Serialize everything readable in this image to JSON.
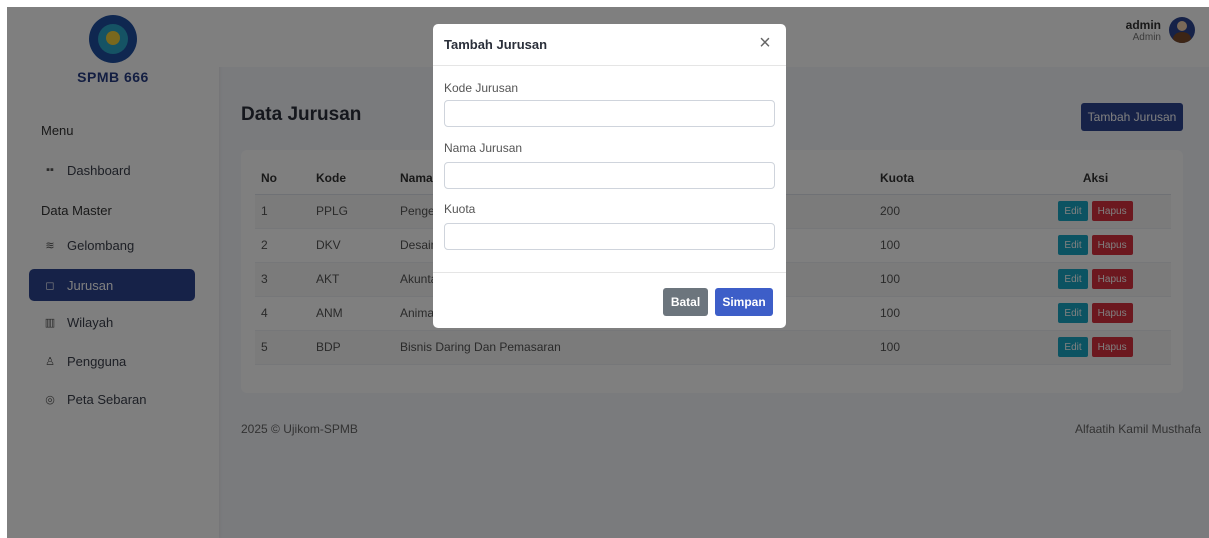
{
  "sidebar": {
    "brand": "SPMB 666",
    "menu_label": "Menu",
    "data_master_label": "Data Master",
    "items": [
      {
        "label": "Dashboard",
        "icon": "grid-icon"
      },
      {
        "label": "Gelombang",
        "icon": "layers-icon"
      },
      {
        "label": "Jurusan",
        "icon": "archive-icon"
      },
      {
        "label": "Wilayah",
        "icon": "map-icon"
      },
      {
        "label": "Pengguna",
        "icon": "user-icon"
      },
      {
        "label": "Peta Sebaran",
        "icon": "pin-icon"
      }
    ]
  },
  "header": {
    "user_name": "admin",
    "user_role": "Admin"
  },
  "main": {
    "title": "Data Jurusan",
    "add_button": "Tambah Jurusan",
    "table": {
      "columns": [
        "No",
        "Kode",
        "Nama Jurusan",
        "Kuota",
        "Aksi"
      ],
      "rows": [
        {
          "no": "1",
          "kode": "PPLG",
          "nama": "Pengembangan Perangkat Lunak Dan Gim",
          "kuota": "200"
        },
        {
          "no": "2",
          "kode": "DKV",
          "nama": "Desain Komunikasi Visual",
          "kuota": "100"
        },
        {
          "no": "3",
          "kode": "AKT",
          "nama": "Akuntansi",
          "kuota": "100"
        },
        {
          "no": "4",
          "kode": "ANM",
          "nama": "Animasi",
          "kuota": "100"
        },
        {
          "no": "5",
          "kode": "BDP",
          "nama": "Bisnis Daring Dan Pemasaran",
          "kuota": "100"
        }
      ],
      "edit_label": "Edit",
      "delete_label": "Hapus"
    }
  },
  "footer": {
    "left": "2025 © Ujikom-SPMB",
    "right": "Alfaatih Kamil Musthafa"
  },
  "modal": {
    "title": "Tambah Jurusan",
    "close_glyph": "×",
    "fields": [
      {
        "label": "Kode Jurusan",
        "value": ""
      },
      {
        "label": "Nama Jurusan",
        "value": ""
      },
      {
        "label": "Kuota",
        "value": ""
      }
    ],
    "cancel_label": "Batal",
    "save_label": "Simpan"
  },
  "colors": {
    "primary": "#2c4491",
    "edit": "#18a6c4",
    "delete": "#d9303f",
    "cancel": "#6c757d",
    "save": "#3d5ec8"
  }
}
